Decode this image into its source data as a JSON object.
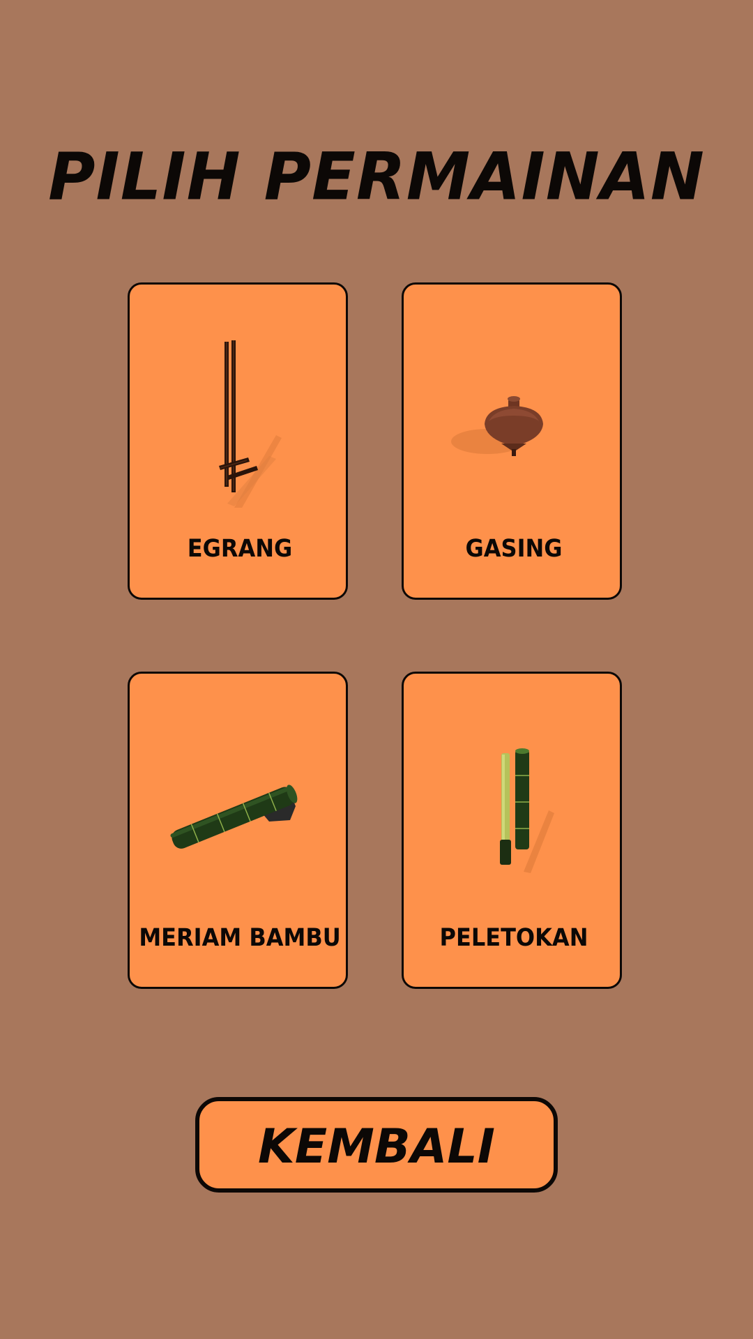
{
  "screen": {
    "title": "PILIH PERMAINAN",
    "background_color": "#a8775c",
    "accent_color": "#fe914b"
  },
  "games": [
    {
      "label": "EGRANG",
      "icon": "stilts-icon"
    },
    {
      "label": "GASING",
      "icon": "spinning-top-icon"
    },
    {
      "label": "MERIAM BAMBU",
      "icon": "bamboo-cannon-icon"
    },
    {
      "label": "PELETOKAN",
      "icon": "bamboo-popgun-icon"
    }
  ],
  "back_button": {
    "label": "KEMBALI"
  }
}
